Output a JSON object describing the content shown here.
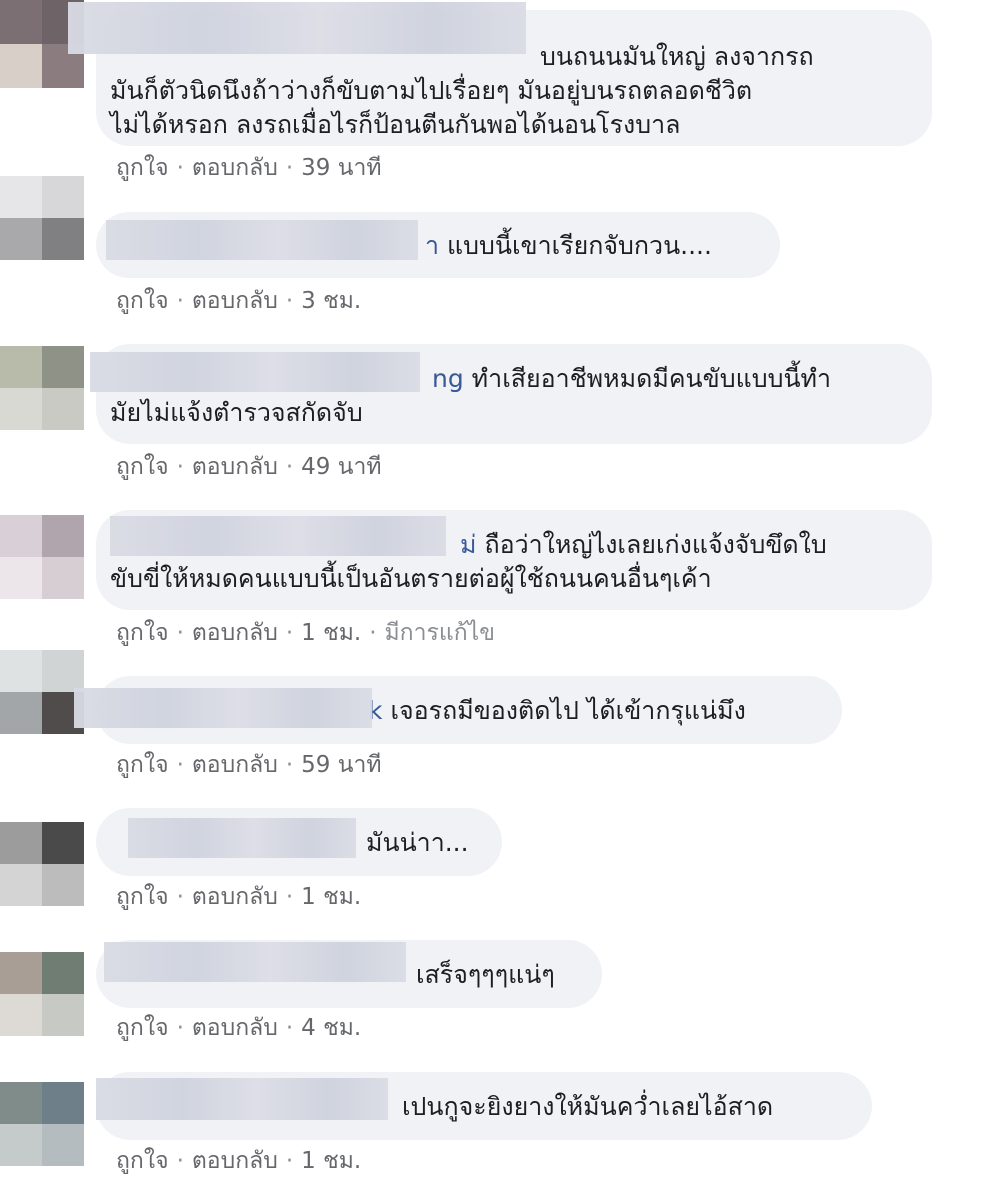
{
  "actions": {
    "like": "ถูกใจ",
    "reply": "ตอบกลับ",
    "separator": "·"
  },
  "comments": [
    {
      "author_tail": "",
      "lines": [
        "บนถนนมันใหญ่ ลงจากรถ",
        "มันก็ตัวนิดนึงถ้าว่างก็ขับตามไปเรื่อยๆ มันอยู่บนรถตลอดชีวิต",
        "ไม่ได้หรอก ลงรถเมื่อไรก็ป้อนตีนกันพอได้นอนโรงบาล"
      ],
      "time": "39 นาที",
      "edited": "",
      "avatar_colors": [
        "#7b6f74",
        "#6e6367",
        "#d9cfc9",
        "#8a7c7f"
      ]
    },
    {
      "author_tail": "า",
      "lines": [
        "แบบนี้เขาเรียกจับกวน...."
      ],
      "time": "3 ชม.",
      "edited": "",
      "avatar_colors": [
        "#a9a9ab",
        "#808082",
        "#d3d3d5",
        "#bcbcbe"
      ]
    },
    {
      "author_tail": "ng",
      "lines": [
        "ทำเสียอาชีพหมดมีคนขับแบบนี้ทำ",
        "มัยไม่แจ้งตำรวจสกัดจับ"
      ],
      "time": "49 นาที",
      "edited": "",
      "avatar_colors": [
        "#b8bba9",
        "#8f9286",
        "#d8d9d3",
        "#c9cac4"
      ]
    },
    {
      "author_tail": "ม่",
      "lines": [
        "ถือว่าใหญ่ไงเลยเก่งแจ้งจับขึดใบ",
        "ขับขี่ให้หมดคนแบบนี้เป็นอันตรายต่อผู้ใช้ถนนคนอื่นๆเค้า"
      ],
      "time": "1 ชม.",
      "edited": "มีการแก้ไข",
      "avatar_colors": [
        "#d9cfd6",
        "#b1a5ad",
        "#ece6ea",
        "#d6ced3"
      ]
    },
    {
      "author_tail": "k",
      "lines": [
        "เจอรถมีของติดไป ได้เข้ากรุแน่มึง"
      ],
      "time": "59 นาที",
      "edited": "",
      "avatar_colors": [
        "#a2a6a8",
        "#4f4c4b",
        "#d8dadb",
        "#bdbfbf"
      ]
    },
    {
      "author_tail": "",
      "lines": [
        "มันน่าา..."
      ],
      "time": "1 ชม.",
      "edited": "",
      "avatar_colors": [
        "#9c9c9c",
        "#4a4a4a",
        "#d4d4d4",
        "#bcbcbc"
      ]
    },
    {
      "author_tail": "",
      "lines": [
        "เสร็จๆๆๆแน่ๆ"
      ],
      "time": "4 ชม.",
      "edited": "",
      "avatar_colors": [
        "#a89e95",
        "#6f7d72",
        "#ddd9d5",
        "#c7c9c5"
      ]
    },
    {
      "author_tail": "",
      "lines": [
        "เปนกูจะยิงยางให้มันคว่ำเลยไอ้สาด"
      ],
      "time": "1 ชม.",
      "edited": "",
      "avatar_colors": [
        "#7f8c8a",
        "#6f7f8a",
        "#c5cbca",
        "#b4bcc0"
      ]
    }
  ]
}
